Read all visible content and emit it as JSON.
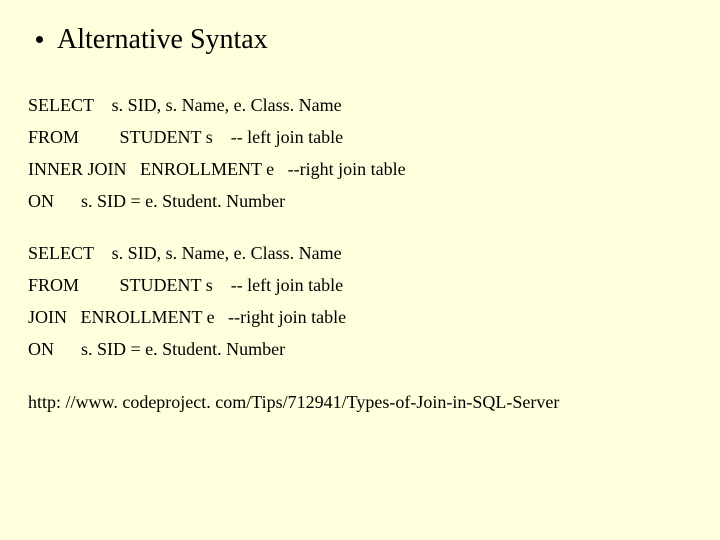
{
  "title": "Alternative Syntax",
  "block1": {
    "l1": "SELECT    s. SID, s. Name, e. Class. Name",
    "l2": "FROM         STUDENT s    -- left join table",
    "l3": "INNER JOIN   ENROLLMENT e   --right join table",
    "l4": "ON      s. SID = e. Student. Number"
  },
  "block2": {
    "l1": "SELECT    s. SID, s. Name, e. Class. Name",
    "l2": "FROM         STUDENT s    -- left join table",
    "l3": "JOIN   ENROLLMENT e   --right join table",
    "l4": "ON      s. SID = e. Student. Number"
  },
  "footer": "http: //www. codeproject. com/Tips/712941/Types-of-Join-in-SQL-Server"
}
